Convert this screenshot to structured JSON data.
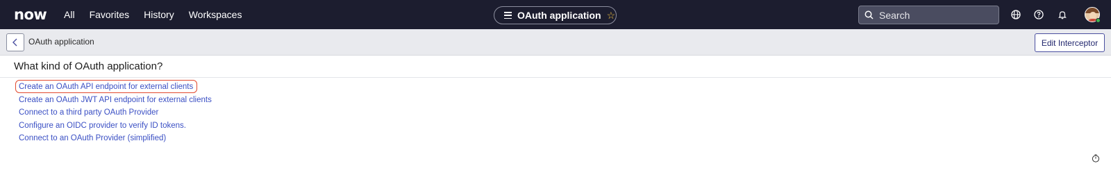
{
  "topnav": {
    "logo": "now",
    "links": [
      "All",
      "Favorites",
      "History",
      "Workspaces"
    ],
    "context_title": "OAuth application",
    "search_placeholder": "Search"
  },
  "header": {
    "title": "OAuth application",
    "edit_button": "Edit Interceptor"
  },
  "main": {
    "question": "What kind of OAuth application?",
    "options": [
      "Create an OAuth API endpoint for external clients",
      "Create an OAuth JWT API endpoint for external clients",
      "Connect to a third party OAuth Provider",
      "Configure an OIDC provider to verify ID tokens.",
      "Connect to an OAuth Provider (simplified)"
    ]
  },
  "colors": {
    "nav_bg": "#1c1d2f",
    "link": "#3a4fc4",
    "highlight": "#e2492f",
    "header_bg": "#e9eaee"
  }
}
